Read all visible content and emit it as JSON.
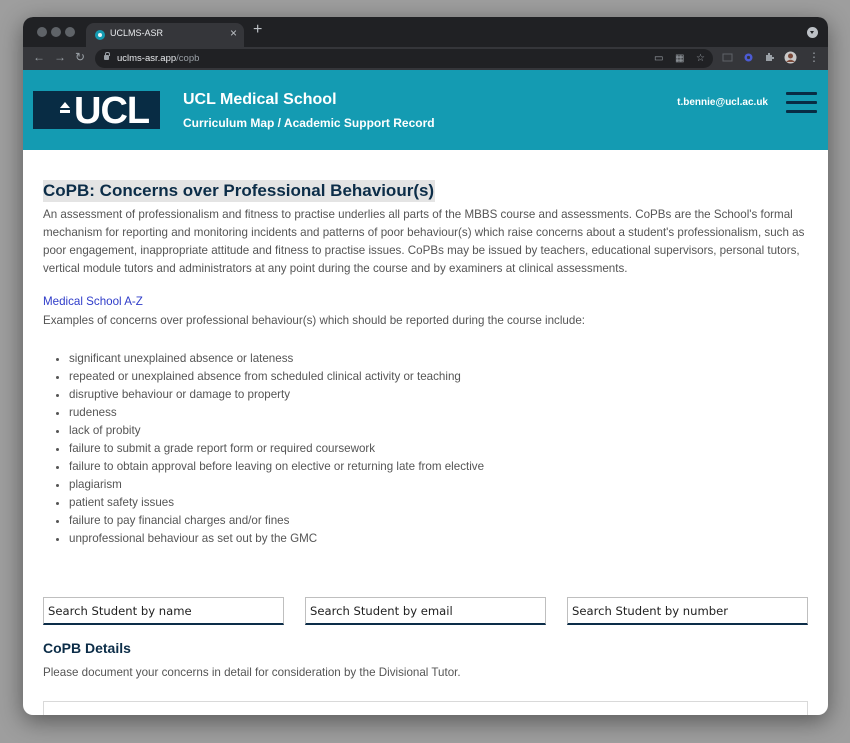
{
  "browser": {
    "tab_title": "UCLMS-ASR",
    "new_tab_label": "+",
    "tab_close_label": "×",
    "url_domain": "uclms-asr.app",
    "url_path": "/copb"
  },
  "header": {
    "logo_text": "UCL",
    "title": "UCL Medical School",
    "subtitle": "Curriculum Map / Academic Support Record",
    "user_email": "t.bennie@ucl.ac.uk",
    "menu_icon": "hamburger-menu-icon"
  },
  "main": {
    "heading": "CoPB: Concerns over Professional Behaviour(s)",
    "intro": "An assessment of professionalism and fitness to practise underlies all parts of the MBBS course and assessments. CoPBs are the School's formal mechanism for reporting and monitoring incidents and patterns of poor behaviour(s) which raise concerns about a student's professionalism, such as poor engagement, inappropriate attitude and fitness to practise issues. CoPBs may be issued by teachers, educational supervisors, personal tutors, vertical module tutors and administrators at any point during the course and by examiners at clinical assessments.",
    "az_link": "Medical School A-Z",
    "examples_intro": "Examples of concerns over professional behaviour(s) which should be reported during the course include:",
    "concerns": [
      "significant unexplained absence or lateness",
      "repeated or unexplained absence from scheduled clinical activity or teaching",
      "disruptive behaviour or damage to property",
      "rudeness",
      "lack of probity",
      "failure to submit a grade report form or required coursework",
      "failure to obtain approval before leaving on elective or returning late from elective",
      "plagiarism",
      "patient safety issues",
      "failure to pay financial charges and/or fines",
      "unprofessional behaviour as set out by the GMC"
    ]
  },
  "search": {
    "by_name_placeholder": "Search Student by name",
    "by_email_placeholder": "Search Student by email",
    "by_number_placeholder": "Search Student by number"
  },
  "copb_details": {
    "title": "CoPB Details",
    "description": "Please document your concerns in detail for consideration by the Divisional Tutor."
  },
  "colors": {
    "header_teal": "#149bb2",
    "navy": "#0c2d48",
    "link_blue": "#2f3cc9"
  }
}
